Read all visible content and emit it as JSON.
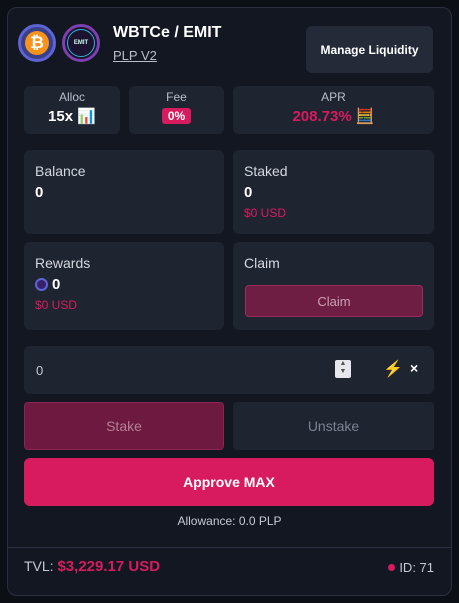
{
  "header": {
    "token_a_symbol": "₿",
    "token_b_label": "EMIT",
    "pair": "WBTCe / EMIT",
    "version": "PLP V2",
    "manage_button": "Manage Liquidity"
  },
  "stats": {
    "alloc_label": "Alloc",
    "alloc_value": "15x",
    "alloc_icon": "chart-icon",
    "fee_label": "Fee",
    "fee_value": "0%",
    "apr_label": "APR",
    "apr_value": "208.73%",
    "apr_icon": "calculator-icon"
  },
  "balance": {
    "label": "Balance",
    "value": "0"
  },
  "staked": {
    "label": "Staked",
    "value": "0",
    "usd": "$0 USD"
  },
  "rewards": {
    "label": "Rewards",
    "value": "0",
    "usd": "$0 USD"
  },
  "claim": {
    "label": "Claim",
    "button": "Claim"
  },
  "amount": {
    "value": "0"
  },
  "actions": {
    "stake": "Stake",
    "unstake": "Unstake",
    "approve": "Approve MAX",
    "allowance": "Allowance: 0.0 PLP"
  },
  "footer": {
    "tvl_label": "TVL:",
    "tvl_value": "$3,229.17 USD",
    "id": "ID: 71"
  },
  "colors": {
    "accent": "#d81b5f",
    "background": "#131722",
    "panel": "#1f2431"
  }
}
